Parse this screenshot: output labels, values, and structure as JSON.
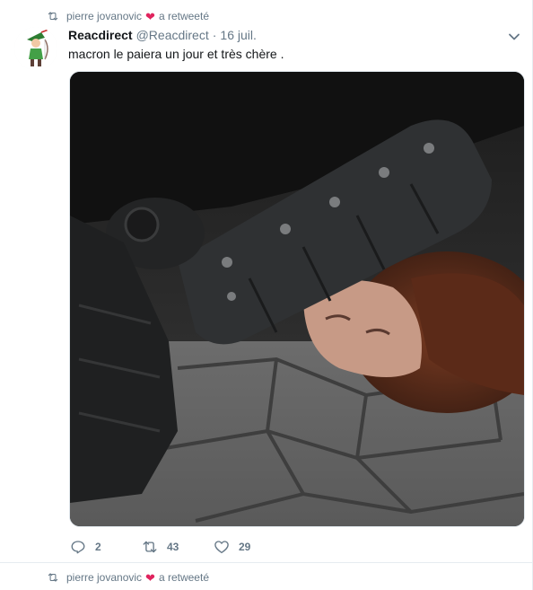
{
  "colors": {
    "accent": "#1da1f2",
    "muted": "#657786",
    "heart": "#e0245e",
    "text": "#14171a",
    "background": "#e6ecf0"
  },
  "tweet": {
    "context": {
      "icon": "retweet-icon",
      "user": "pierre jovanovic",
      "emoji": "heart-emoji",
      "action": "a retweeté"
    },
    "author": {
      "avatar_icon": "archer-avatar",
      "display_name": "Reacdirect",
      "handle": "@Reacdirect",
      "separator": "·",
      "date": "16 juil."
    },
    "menu_icon": "chevron-down-icon",
    "text": "macron le paiera un jour et très chère .",
    "media": {
      "description_icon": "photo"
    },
    "actions": {
      "reply_count": "2",
      "retweet_count": "43",
      "like_count": "29"
    }
  },
  "next_tweet": {
    "context": {
      "user": "pierre jovanovic",
      "action": "a retweeté"
    }
  }
}
